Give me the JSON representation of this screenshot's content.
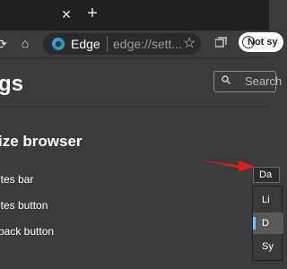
{
  "browser": {
    "site_name": "Edge",
    "url": "edge://sett...",
    "sync_label": "Not sy"
  },
  "page": {
    "title": "gs",
    "search_placeholder": "Search"
  },
  "section": {
    "heading": "ize browser",
    "settings": [
      {
        "label": "ites bar"
      },
      {
        "label": "ites button"
      },
      {
        "label": "back button"
      }
    ]
  },
  "dropdown": {
    "selected": "Da",
    "options": [
      "Li",
      "D",
      "Sy"
    ]
  },
  "colors": {
    "accent": "#74c0ff",
    "annotation_arrow": "#e21b1b",
    "background": "#3b3b3b",
    "tabstrip": "#202020"
  }
}
